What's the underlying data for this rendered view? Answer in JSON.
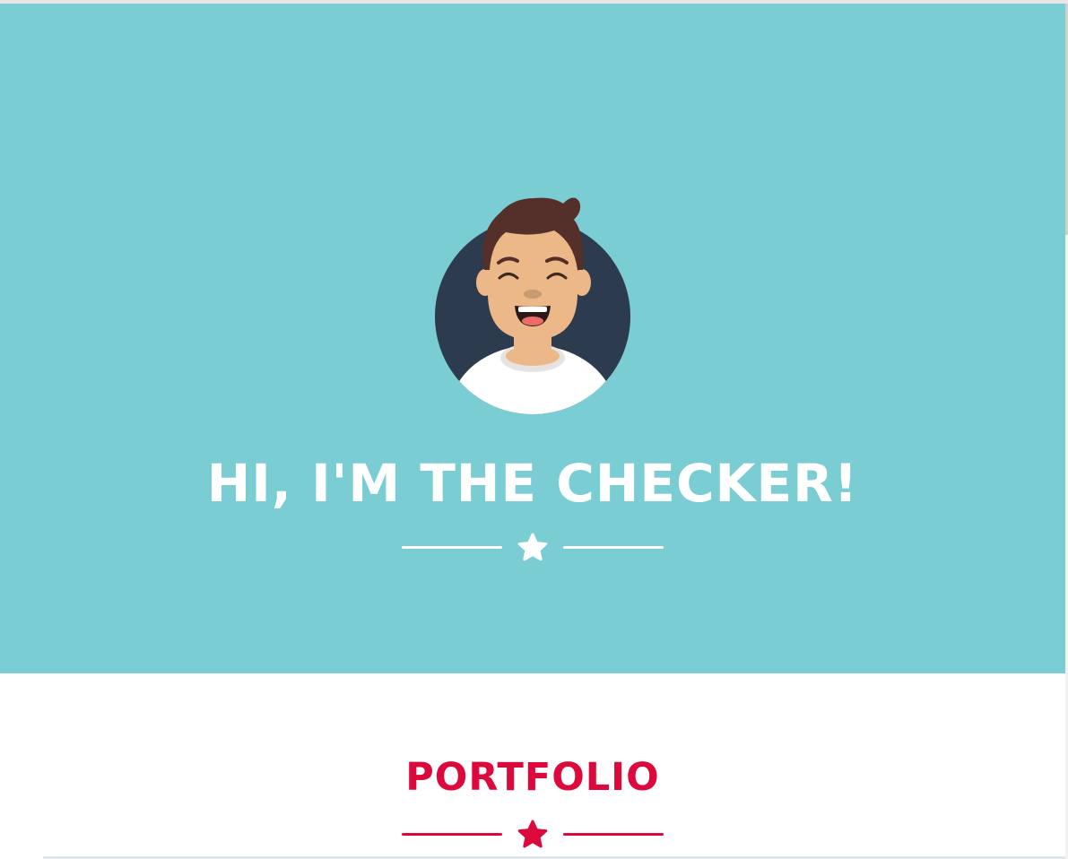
{
  "hero": {
    "title": "HI, I'M THE CHECKER!",
    "background_color": "#79cdd3",
    "avatar_icon": "smiling-person-avatar",
    "divider_icon": "star-icon"
  },
  "portfolio": {
    "title": "PORTFOLIO",
    "accent_color": "#dc0a3c",
    "divider_icon": "star-icon"
  }
}
